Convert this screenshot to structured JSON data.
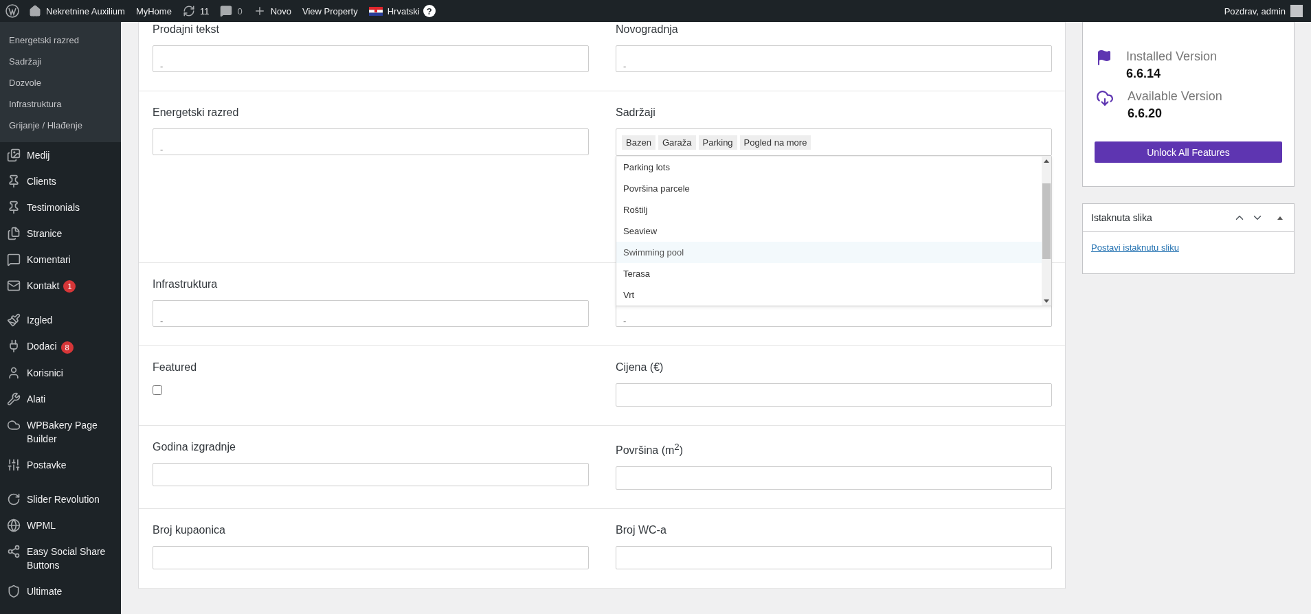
{
  "admin_bar": {
    "items": [
      {
        "label": "Nekretnine Auxilium"
      },
      {
        "label": "MyHome"
      },
      {
        "label": "11"
      },
      {
        "label": "0"
      },
      {
        "label": "Novo"
      },
      {
        "label": "View Property"
      },
      {
        "label": "Hrvatski"
      }
    ],
    "help": "?",
    "greeting": "Pozdrav, admin"
  },
  "sidebar": {
    "submenu": [
      "Energetski razred",
      "Sadržaji",
      "Dozvole",
      "Infrastruktura",
      "Grijanje / Hlađenje"
    ],
    "groups": [
      {
        "items": [
          {
            "label": "Medij"
          },
          {
            "label": "Clients"
          },
          {
            "label": "Testimonials"
          },
          {
            "label": "Stranice"
          },
          {
            "label": "Komentari"
          },
          {
            "label": "Kontakt",
            "badge": "1"
          }
        ]
      },
      {
        "items": [
          {
            "label": "Izgled"
          },
          {
            "label": "Dodaci",
            "badge": "8"
          },
          {
            "label": "Korisnici"
          },
          {
            "label": "Alati"
          },
          {
            "label": "WPBakery Page Builder"
          },
          {
            "label": "Postavke"
          }
        ]
      },
      {
        "items": [
          {
            "label": "Slider Revolution"
          },
          {
            "label": "WPML"
          },
          {
            "label": "Easy Social Share Buttons"
          },
          {
            "label": "Ultimate"
          }
        ]
      }
    ]
  },
  "form": {
    "rows": [
      {
        "fields": [
          {
            "kind": "select",
            "label": "Prodajni tekst",
            "value": "-"
          },
          {
            "kind": "select",
            "label": "Novogradnja",
            "value": "-"
          }
        ]
      },
      {
        "fields": [
          {
            "kind": "select",
            "label": "Energetski razred",
            "value": "-"
          },
          {
            "kind": "multiselect",
            "label": "Sadržaji",
            "tags": [
              "Bazen",
              "Garaža",
              "Parking",
              "Pogled na more"
            ],
            "open": true,
            "options": [
              {
                "label": "Parking lots",
                "highlighted": false
              },
              {
                "label": "Površina parcele",
                "highlighted": false
              },
              {
                "label": "Roštilj",
                "highlighted": false
              },
              {
                "label": "Seaview",
                "highlighted": false
              },
              {
                "label": "Swimming pool",
                "highlighted": true
              },
              {
                "label": "Terasa",
                "highlighted": false
              },
              {
                "label": "Vrt",
                "highlighted": false
              }
            ]
          }
        ]
      },
      {
        "fields": [
          {
            "kind": "select",
            "label": "Infrastruktura",
            "value": "-"
          },
          {
            "kind": "select",
            "value": "-"
          }
        ]
      },
      {
        "fields": [
          {
            "kind": "checkbox",
            "label": "Featured",
            "checked": false
          },
          {
            "kind": "input",
            "label": "Cijena (€)"
          }
        ]
      },
      {
        "fields": [
          {
            "kind": "input",
            "label": "Godina izgradnje"
          },
          {
            "kind": "input",
            "label": "Površina (m$^{2}$)"
          }
        ]
      },
      {
        "fields": [
          {
            "kind": "input",
            "label": "Broj kupaonica"
          },
          {
            "kind": "input",
            "label": "Broj WC-a"
          }
        ]
      }
    ]
  },
  "version_box": {
    "items": [
      {
        "label": "Installed Version",
        "value": "6.6.14"
      },
      {
        "label": "Available Version",
        "value": "6.6.20"
      }
    ],
    "button": "Unlock All Features"
  },
  "featured_image_box": {
    "title": "Istaknuta slika",
    "link": "Postavi istaknutu sliku"
  }
}
